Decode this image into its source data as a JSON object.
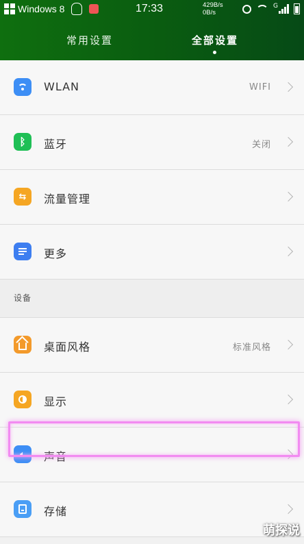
{
  "status_bar": {
    "carrier": "Windows 8",
    "time": "17:33",
    "speed_up": "429B/s",
    "speed_down": "0B/s",
    "signal_label": "G"
  },
  "tabs": {
    "common": "常用设置",
    "all": "全部设置",
    "active": "all"
  },
  "rows_top": [
    {
      "label": "WLAN",
      "value": "WIFI",
      "icon": "wifi-icon",
      "color": "#3d8ef5"
    },
    {
      "label": "蓝牙",
      "value": "关闭",
      "icon": "bluetooth-icon",
      "color": "#1fbf55"
    },
    {
      "label": "流量管理",
      "value": "",
      "icon": "data-usage-icon",
      "color": "#f5a623"
    },
    {
      "label": "更多",
      "value": "",
      "icon": "more-icon",
      "color": "#3d7ef0"
    }
  ],
  "section": {
    "label": "设备"
  },
  "rows_device": [
    {
      "label": "桌面风格",
      "value": "标准风格",
      "icon": "home-icon",
      "color": "#f39a2b"
    },
    {
      "label": "显示",
      "value": "",
      "icon": "display-icon",
      "color": "#f5a623"
    },
    {
      "label": "声音",
      "value": "",
      "icon": "sound-icon",
      "color": "#3d8ef5"
    },
    {
      "label": "存储",
      "value": "",
      "icon": "storage-icon",
      "color": "#4a9ef5"
    }
  ],
  "watermark": "萌探说"
}
